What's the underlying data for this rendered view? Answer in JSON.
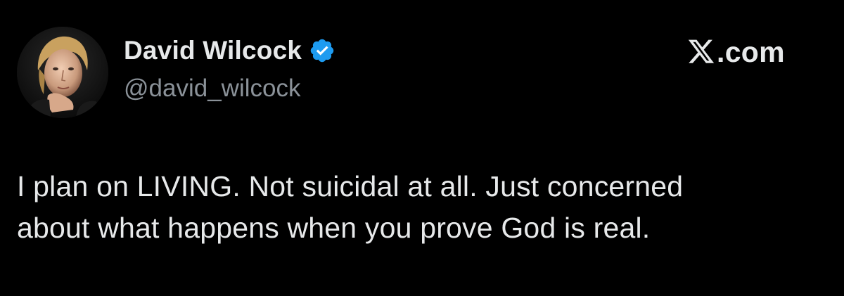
{
  "tweet": {
    "author": {
      "display_name": "David Wilcock",
      "handle": "@david_wilcock",
      "verified": true,
      "verified_badge_color": "#1d9bf0",
      "avatar_icon": "profile-photo"
    },
    "brand": {
      "suffix": ".com",
      "logo_icon": "x-logo-icon"
    },
    "text_lines": [
      "I plan on LIVING. Not suicidal at all. Just concerned",
      "about what happens when you prove God is real."
    ]
  },
  "colors": {
    "background": "#000000",
    "primary_text": "#e7e9ea",
    "secondary_text": "#8b9299",
    "verified_blue": "#1d9bf0"
  }
}
